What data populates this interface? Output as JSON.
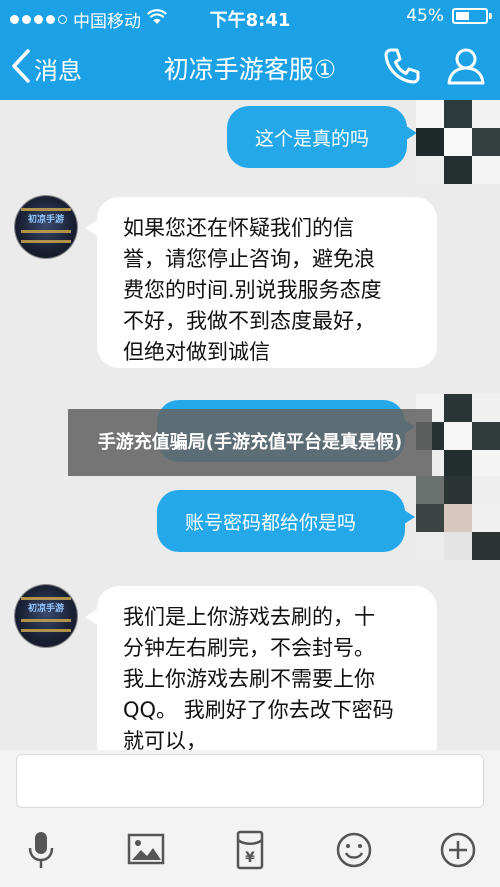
{
  "status": {
    "carrier": "中国移动",
    "time": "下午8:41",
    "battery": "45%",
    "battery_level": 0.45
  },
  "nav": {
    "back_label": "消息",
    "title": "初凉手游客服①"
  },
  "messages": [
    {
      "from": "user",
      "text": "这个是真的吗"
    },
    {
      "from": "service",
      "text": "如果您还在怀疑我们的信\n誉，请您停止咨询，避免浪\n费您的时间.别说我服务态度\n不好，我做不到态度最好，\n但绝对做到诚信"
    },
    {
      "from": "user",
      "text": "账号密码都给你是吗"
    },
    {
      "from": "service",
      "text": "我们是上你游戏去刷的，十\n分钟左右刷完，不会封号。\n我上你游戏去刷不需要上你\nQQ。 我刷好了你去改下密码\n就可以，"
    }
  ],
  "banner": "手游充值骗局(手游充值平台是真是假)",
  "input": {
    "value": "",
    "placeholder": ""
  },
  "toolbar": {
    "items": [
      "microphone-icon",
      "image-icon",
      "red-packet-icon",
      "emoji-icon",
      "plus-icon"
    ]
  },
  "colors": {
    "accent": "#1da1e6",
    "bubble_out": "#24a8ea",
    "bubble_in": "#ffffff",
    "background": "#ebebeb",
    "icon_gray": "#555555"
  }
}
